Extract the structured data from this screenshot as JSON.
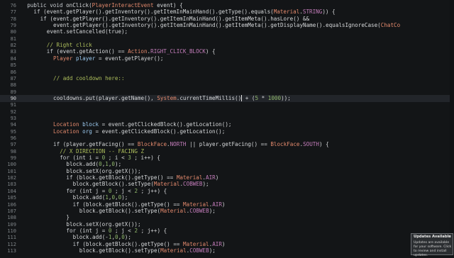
{
  "editor": {
    "lines": [
      {
        "n": "76",
        "indent": 2,
        "tokens": [
          [
            "kw",
            "public void "
          ],
          [
            "mem",
            "onClick"
          ],
          [
            "op",
            "("
          ],
          [
            "type",
            "PlayerInteractEvent"
          ],
          [
            "op",
            " event) {"
          ]
        ]
      },
      {
        "n": "77",
        "indent": 4,
        "tokens": [
          [
            "kw",
            "if "
          ],
          [
            "op",
            "(event.getPlayer().getInventory().getItemInMainHand().getType().equals("
          ],
          [
            "type",
            "Material"
          ],
          [
            "op",
            "."
          ],
          [
            "const",
            "STRING"
          ],
          [
            "op",
            ")) {"
          ]
        ]
      },
      {
        "n": "78",
        "indent": 6,
        "tokens": [
          [
            "kw",
            "if "
          ],
          [
            "op",
            "(event.getPlayer().getInventory().getItemInMainHand().getItemMeta().hasLore() &&"
          ]
        ]
      },
      {
        "n": "79",
        "indent": 10,
        "tokens": [
          [
            "op",
            "event.getPlayer().getInventory().getItemInMainHand().getItemMeta().getDisplayName().equalsIgnoreCase("
          ],
          [
            "type",
            "ChatCo"
          ]
        ]
      },
      {
        "n": "80",
        "indent": 8,
        "tokens": [
          [
            "op",
            "event.setCancelled(true);"
          ]
        ]
      },
      {
        "n": "81",
        "indent": 0,
        "tokens": []
      },
      {
        "n": "82",
        "indent": 8,
        "tokens": [
          [
            "comment",
            "// Right click"
          ]
        ]
      },
      {
        "n": "83",
        "indent": 8,
        "tokens": [
          [
            "kw",
            "if "
          ],
          [
            "op",
            "(event.getAction() == "
          ],
          [
            "type",
            "Action"
          ],
          [
            "op",
            "."
          ],
          [
            "const",
            "RIGHT_CLICK_BLOCK"
          ],
          [
            "op",
            ") {"
          ]
        ]
      },
      {
        "n": "84",
        "indent": 10,
        "tokens": [
          [
            "type",
            "Player "
          ],
          [
            "var",
            "player"
          ],
          [
            "op",
            " = event.getPlayer();"
          ]
        ]
      },
      {
        "n": "85",
        "indent": 0,
        "tokens": []
      },
      {
        "n": "86",
        "indent": 0,
        "tokens": []
      },
      {
        "n": "87",
        "indent": 10,
        "tokens": [
          [
            "comment",
            "// add cooldown here::"
          ]
        ]
      },
      {
        "n": "88",
        "indent": 0,
        "tokens": []
      },
      {
        "n": "89",
        "indent": 0,
        "tokens": []
      },
      {
        "n": "90",
        "indent": 10,
        "current": true,
        "tokens": [
          [
            "op",
            "cooldowns.put(player.getName(), "
          ],
          [
            "type",
            "System"
          ],
          [
            "op",
            ".currentTimeMillis()"
          ],
          [
            "caret",
            ""
          ],
          [
            "op",
            " + ("
          ],
          [
            "num",
            "5"
          ],
          [
            "op",
            " * "
          ],
          [
            "num",
            "1000"
          ],
          [
            "op",
            "));"
          ]
        ]
      },
      {
        "n": "91",
        "indent": 0,
        "tokens": []
      },
      {
        "n": "92",
        "indent": 0,
        "tokens": []
      },
      {
        "n": "93",
        "indent": 0,
        "tokens": []
      },
      {
        "n": "94",
        "indent": 10,
        "tokens": [
          [
            "type",
            "Location "
          ],
          [
            "var",
            "block"
          ],
          [
            "op",
            " = event.getClickedBlock().getLocation();"
          ]
        ]
      },
      {
        "n": "95",
        "indent": 10,
        "tokens": [
          [
            "type",
            "Location "
          ],
          [
            "var",
            "org"
          ],
          [
            "op",
            " = event.getClickedBlock().getLocation();"
          ]
        ]
      },
      {
        "n": "96",
        "indent": 0,
        "tokens": []
      },
      {
        "n": "97",
        "indent": 10,
        "tokens": [
          [
            "kw",
            "if "
          ],
          [
            "op",
            "(player.getFacing() == "
          ],
          [
            "type",
            "BlockFace"
          ],
          [
            "op",
            "."
          ],
          [
            "const",
            "NORTH"
          ],
          [
            "op",
            " || player.getFacing() == "
          ],
          [
            "type",
            "BlockFace"
          ],
          [
            "op",
            "."
          ],
          [
            "const",
            "SOUTH"
          ],
          [
            "op",
            ") {"
          ]
        ]
      },
      {
        "n": "98",
        "indent": 12,
        "tokens": [
          [
            "comment",
            "// X DIRECTION -- FACING Z"
          ]
        ]
      },
      {
        "n": "99",
        "indent": 12,
        "tokens": [
          [
            "kw",
            "for "
          ],
          [
            "op",
            "(int i = "
          ],
          [
            "num",
            "0"
          ],
          [
            "op",
            " ; i < "
          ],
          [
            "num",
            "3"
          ],
          [
            "op",
            " ; i++) {"
          ]
        ]
      },
      {
        "n": "100",
        "indent": 14,
        "tokens": [
          [
            "op",
            "block.add("
          ],
          [
            "num",
            "0"
          ],
          [
            "op",
            ","
          ],
          [
            "num",
            "1"
          ],
          [
            "op",
            ","
          ],
          [
            "num",
            "0"
          ],
          [
            "op",
            ");"
          ]
        ]
      },
      {
        "n": "101",
        "indent": 14,
        "tokens": [
          [
            "op",
            "block.setX(org.getX());"
          ]
        ]
      },
      {
        "n": "102",
        "indent": 14,
        "tokens": [
          [
            "kw",
            "if "
          ],
          [
            "op",
            "(block.getBlock().getType() == "
          ],
          [
            "type",
            "Material"
          ],
          [
            "op",
            "."
          ],
          [
            "const",
            "AIR"
          ],
          [
            "op",
            ")"
          ]
        ]
      },
      {
        "n": "103",
        "indent": 16,
        "tokens": [
          [
            "op",
            "block.getBlock().setType("
          ],
          [
            "type",
            "Material"
          ],
          [
            "op",
            "."
          ],
          [
            "const",
            "COBWEB"
          ],
          [
            "op",
            ");"
          ]
        ]
      },
      {
        "n": "104",
        "indent": 14,
        "tokens": [
          [
            "kw",
            "for "
          ],
          [
            "op",
            "(int j = "
          ],
          [
            "num",
            "0"
          ],
          [
            "op",
            " ; j < "
          ],
          [
            "num",
            "2"
          ],
          [
            "op",
            " ; j++) {"
          ]
        ]
      },
      {
        "n": "105",
        "indent": 16,
        "tokens": [
          [
            "op",
            "block.add("
          ],
          [
            "num",
            "1"
          ],
          [
            "op",
            ","
          ],
          [
            "num",
            "0"
          ],
          [
            "op",
            ","
          ],
          [
            "num",
            "0"
          ],
          [
            "op",
            ");"
          ]
        ]
      },
      {
        "n": "106",
        "indent": 16,
        "tokens": [
          [
            "kw",
            "if "
          ],
          [
            "op",
            "(block.getBlock().getType() == "
          ],
          [
            "type",
            "Material"
          ],
          [
            "op",
            "."
          ],
          [
            "const",
            "AIR"
          ],
          [
            "op",
            ")"
          ]
        ]
      },
      {
        "n": "107",
        "indent": 18,
        "tokens": [
          [
            "op",
            "block.getBlock().setType("
          ],
          [
            "type",
            "Material"
          ],
          [
            "op",
            "."
          ],
          [
            "const",
            "COBWEB"
          ],
          [
            "op",
            ");"
          ]
        ]
      },
      {
        "n": "108",
        "indent": 14,
        "tokens": [
          [
            "op",
            "}"
          ]
        ]
      },
      {
        "n": "109",
        "indent": 14,
        "tokens": [
          [
            "op",
            "block.setX(org.getX());"
          ]
        ]
      },
      {
        "n": "110",
        "indent": 14,
        "tokens": [
          [
            "kw",
            "for "
          ],
          [
            "op",
            "(int j = "
          ],
          [
            "num",
            "0"
          ],
          [
            "op",
            " ; j < "
          ],
          [
            "num",
            "2"
          ],
          [
            "op",
            " ; j++) {"
          ]
        ]
      },
      {
        "n": "111",
        "indent": 16,
        "tokens": [
          [
            "op",
            "block.add(-"
          ],
          [
            "num",
            "1"
          ],
          [
            "op",
            ","
          ],
          [
            "num",
            "0"
          ],
          [
            "op",
            ","
          ],
          [
            "num",
            "0"
          ],
          [
            "op",
            ");"
          ]
        ]
      },
      {
        "n": "112",
        "indent": 16,
        "tokens": [
          [
            "kw",
            "if "
          ],
          [
            "op",
            "(block.getBlock().getType() == "
          ],
          [
            "type",
            "Material"
          ],
          [
            "op",
            "."
          ],
          [
            "const",
            "AIR"
          ],
          [
            "op",
            ")"
          ]
        ]
      },
      {
        "n": "113",
        "indent": 18,
        "tokens": [
          [
            "op",
            "block.getBlock().setType("
          ],
          [
            "type",
            "Material"
          ],
          [
            "op",
            "."
          ],
          [
            "const",
            "COBWEB"
          ],
          [
            "op",
            ");"
          ]
        ]
      }
    ]
  },
  "toast": {
    "title": "Updates Available",
    "close_glyph": "×",
    "body": "Updates are available for your software. Click to review and install updates."
  }
}
